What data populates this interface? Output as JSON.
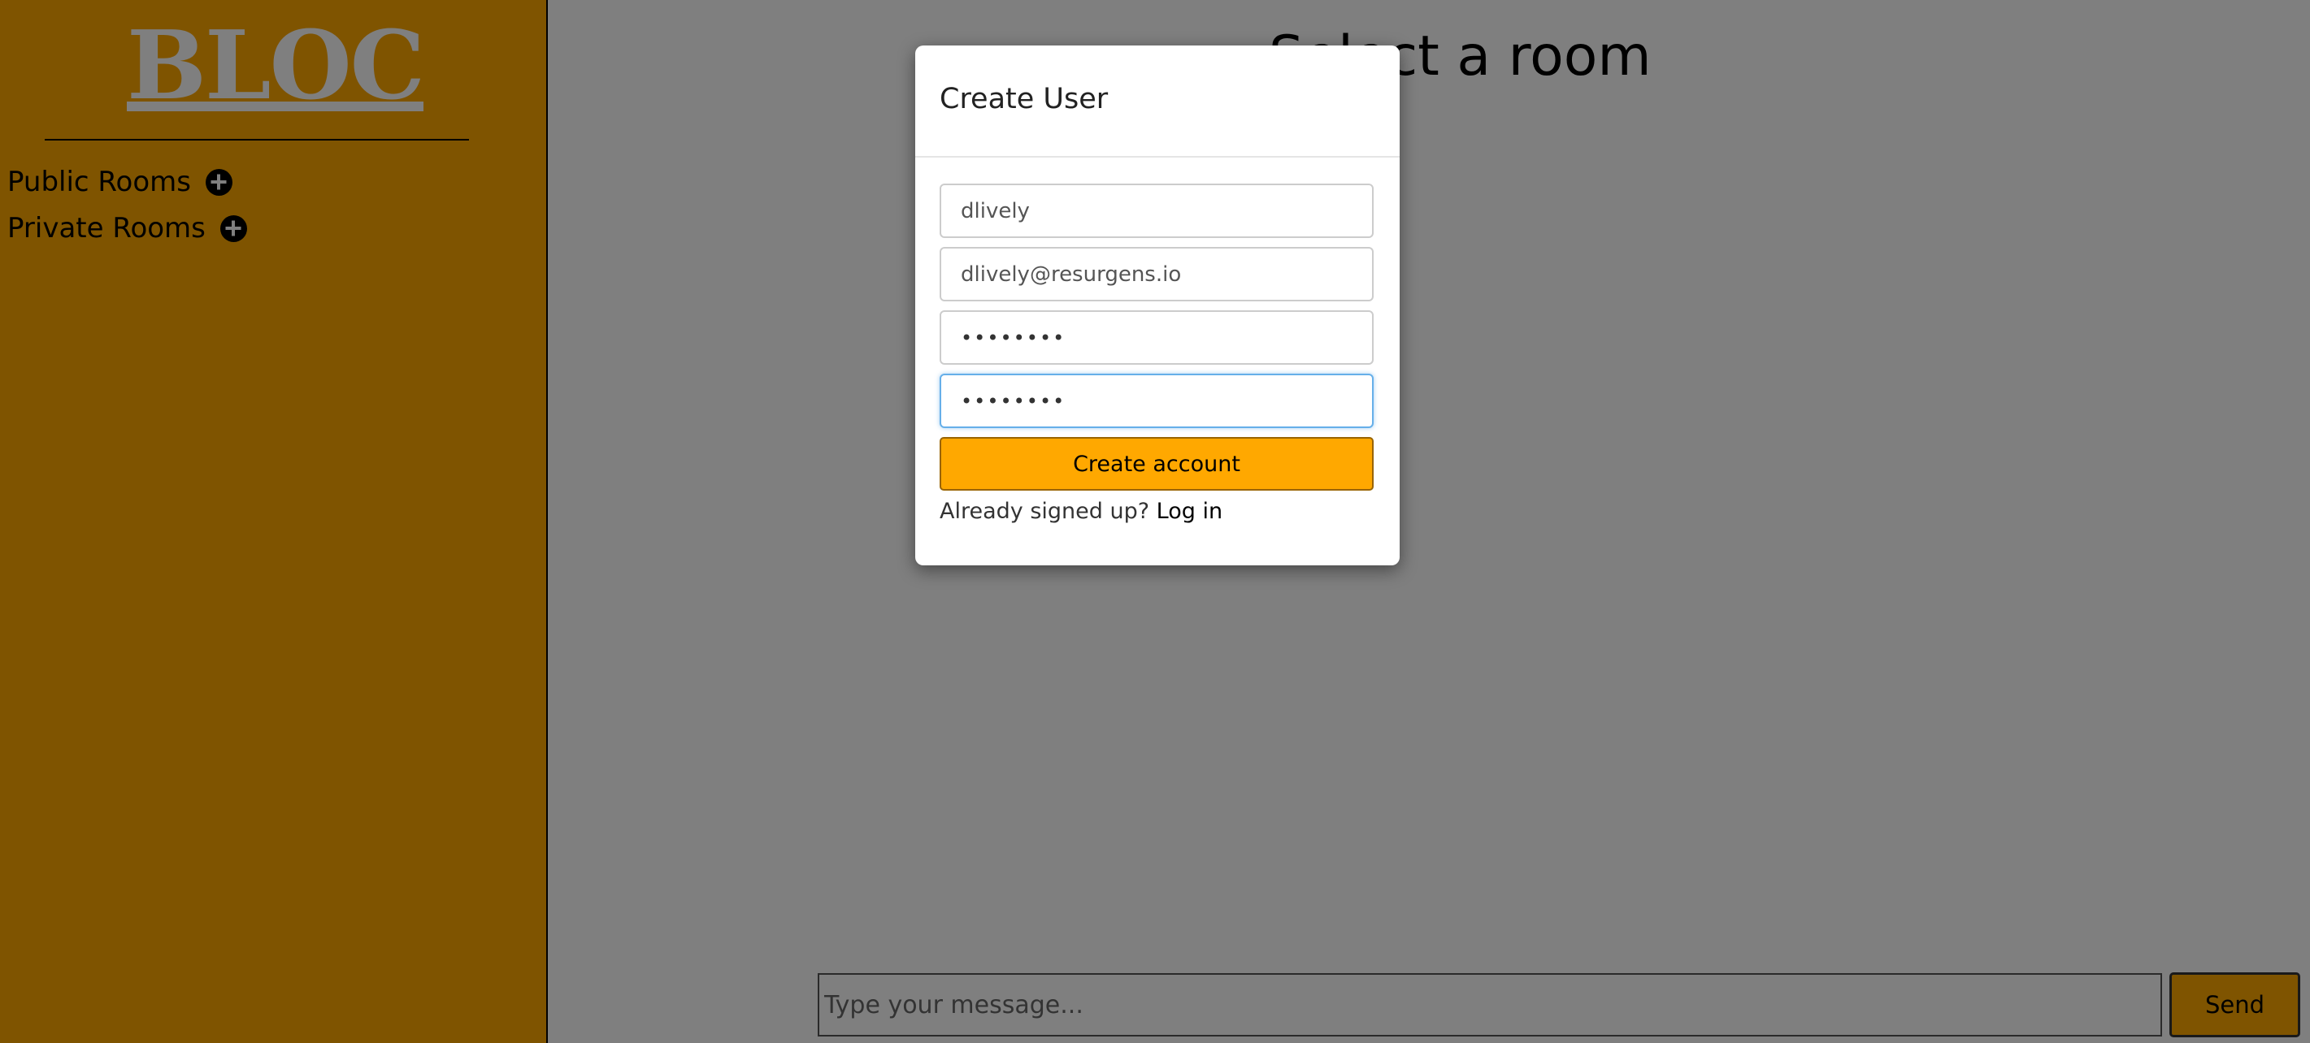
{
  "sidebar": {
    "logo": "BLOC",
    "rooms": {
      "public_label": "Public Rooms",
      "private_label": "Private Rooms",
      "add_icon": "plus-circle-icon"
    }
  },
  "main": {
    "title": "Select a room",
    "message_placeholder": "Type your message...",
    "send_label": "Send"
  },
  "modal": {
    "title": "Create User",
    "username_value": "dlively",
    "email_value": "dlively@resurgens.io",
    "password_value": "••••••••",
    "confirm_password_value": "••••••••",
    "create_label": "Create account",
    "signed_up_text": "Already signed up?",
    "login_label": "Log in"
  },
  "colors": {
    "accent": "#ffa800",
    "overlay": "rgba(0,0,0,0.5)"
  }
}
